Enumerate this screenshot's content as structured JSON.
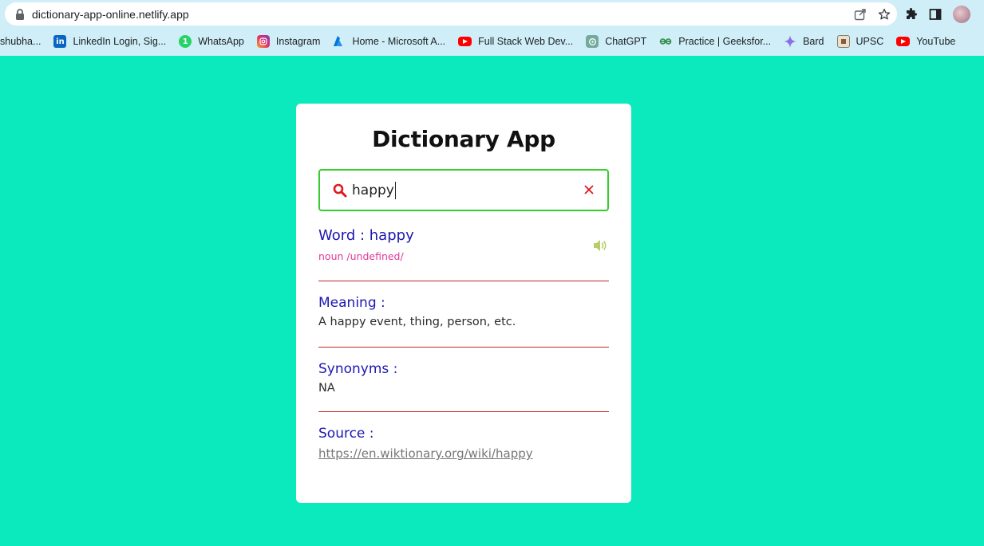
{
  "browser": {
    "url": "dictionary-app-online.netlify.app",
    "bookmarks": [
      {
        "label": "shubha...",
        "icon": "none"
      },
      {
        "label": "LinkedIn Login, Sig...",
        "icon": "linkedin-icon"
      },
      {
        "label": "WhatsApp",
        "icon": "whatsapp-icon"
      },
      {
        "label": "Instagram",
        "icon": "instagram-icon"
      },
      {
        "label": "Home - Microsoft A...",
        "icon": "azure-icon"
      },
      {
        "label": "Full Stack Web Dev...",
        "icon": "youtube-icon"
      },
      {
        "label": "ChatGPT",
        "icon": "chatgpt-icon"
      },
      {
        "label": "Practice | Geeksfor...",
        "icon": "geeksforgeeks-icon"
      },
      {
        "label": "Bard",
        "icon": "bard-icon"
      },
      {
        "label": "UPSC",
        "icon": "upsc-icon"
      },
      {
        "label": "YouTube",
        "icon": "youtube-icon"
      }
    ],
    "whatsapp_badge": "1"
  },
  "app": {
    "title": "Dictionary App",
    "search": {
      "value": "happy"
    },
    "word": {
      "label": "Word : happy",
      "phonetic": "noun /undefined/"
    },
    "meaning": {
      "heading": "Meaning :",
      "text": "A happy event, thing, person, etc."
    },
    "synonyms": {
      "heading": "Synonyms :",
      "text": "NA"
    },
    "source": {
      "heading": "Source :",
      "url": "https://en.wiktionary.org/wiki/happy"
    }
  },
  "colors": {
    "page_bg": "#0beabc",
    "heading_blue": "#1d18b0",
    "phonetic_pink": "#e0399c",
    "divider_red": "#c8232a",
    "search_border_green": "#34cd2a",
    "icon_red": "#e0191f",
    "speaker_green": "#b8cc6a"
  }
}
